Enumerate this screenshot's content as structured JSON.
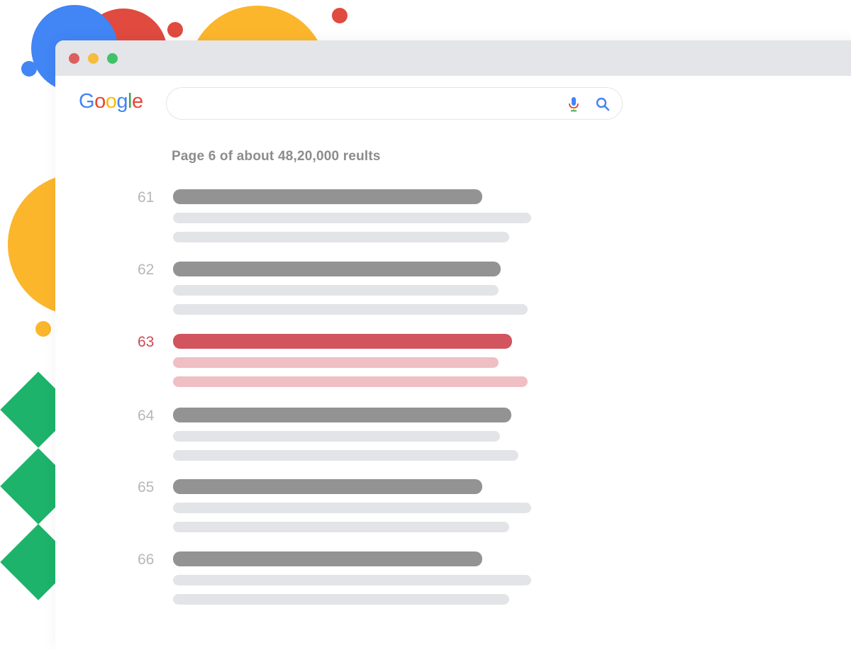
{
  "colors": {
    "google_blue": "#4285f4",
    "google_red": "#ea4335",
    "google_yellow": "#fbbc05",
    "google_green": "#34a853",
    "highlight_red": "#d1545e",
    "decor_green": "#1db36a",
    "decor_yellow": "#fbb62c"
  },
  "window": {
    "controls": [
      "close-dot",
      "minimize-dot",
      "maximize-dot"
    ]
  },
  "search": {
    "logo_letters": [
      "G",
      "o",
      "o",
      "g",
      "l",
      "e"
    ],
    "value": "",
    "icons": [
      "mic-icon",
      "search-icon"
    ]
  },
  "stats": {
    "text": "Page 6 of about 48,20,000 reults"
  },
  "results": [
    {
      "number": "61",
      "highlighted": false
    },
    {
      "number": "62",
      "highlighted": false
    },
    {
      "number": "63",
      "highlighted": true
    },
    {
      "number": "64",
      "highlighted": false
    },
    {
      "number": "65",
      "highlighted": false
    },
    {
      "number": "66",
      "highlighted": false
    }
  ]
}
